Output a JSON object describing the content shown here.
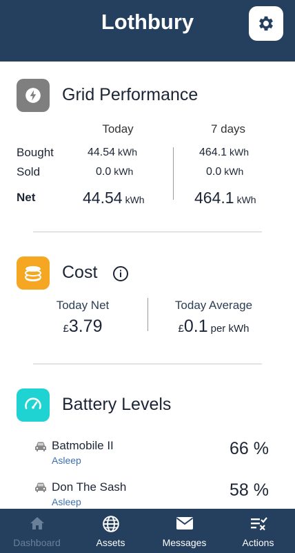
{
  "header": {
    "title": "Lothbury",
    "settings_icon": "gear-icon"
  },
  "grid": {
    "title": "Grid Performance",
    "icon": "lightning-icon",
    "col_today": "Today",
    "col_7days": "7 days",
    "rows": {
      "bought": {
        "label": "Bought",
        "today": "44.54",
        "week": "464.1"
      },
      "sold": {
        "label": "Sold",
        "today": "0.0",
        "week": "0.0"
      },
      "net": {
        "label": "Net",
        "today": "44.54",
        "week": "464.1"
      }
    },
    "unit": "kWh"
  },
  "cost": {
    "title": "Cost",
    "icon": "coins-icon",
    "info_icon": "info-icon",
    "today_net_label": "Today Net",
    "today_net_currency": "£",
    "today_net_value": "3.79",
    "today_avg_label": "Today Average",
    "today_avg_currency": "£",
    "today_avg_value": "0.1",
    "today_avg_unit": "per kWh"
  },
  "battery": {
    "title": "Battery Levels",
    "icon": "gauge-icon",
    "items": [
      {
        "name": "Batmobile II",
        "status": "Asleep",
        "level": "66 %"
      },
      {
        "name": "Don The Sash",
        "status": "Asleep",
        "level": "58 %"
      }
    ]
  },
  "nav": {
    "items": [
      {
        "label": "Dashboard",
        "icon": "home-icon",
        "active": true
      },
      {
        "label": "Assets",
        "icon": "globe-icon",
        "active": false
      },
      {
        "label": "Messages",
        "icon": "envelope-icon",
        "active": false
      },
      {
        "label": "Actions",
        "icon": "checklist-icon",
        "active": false
      }
    ]
  },
  "colors": {
    "header_bg": "#25405f",
    "grid_icon_bg": "#7f7f7f",
    "cost_icon_bg": "#f5a623",
    "battery_icon_bg": "#1fd3d3"
  }
}
